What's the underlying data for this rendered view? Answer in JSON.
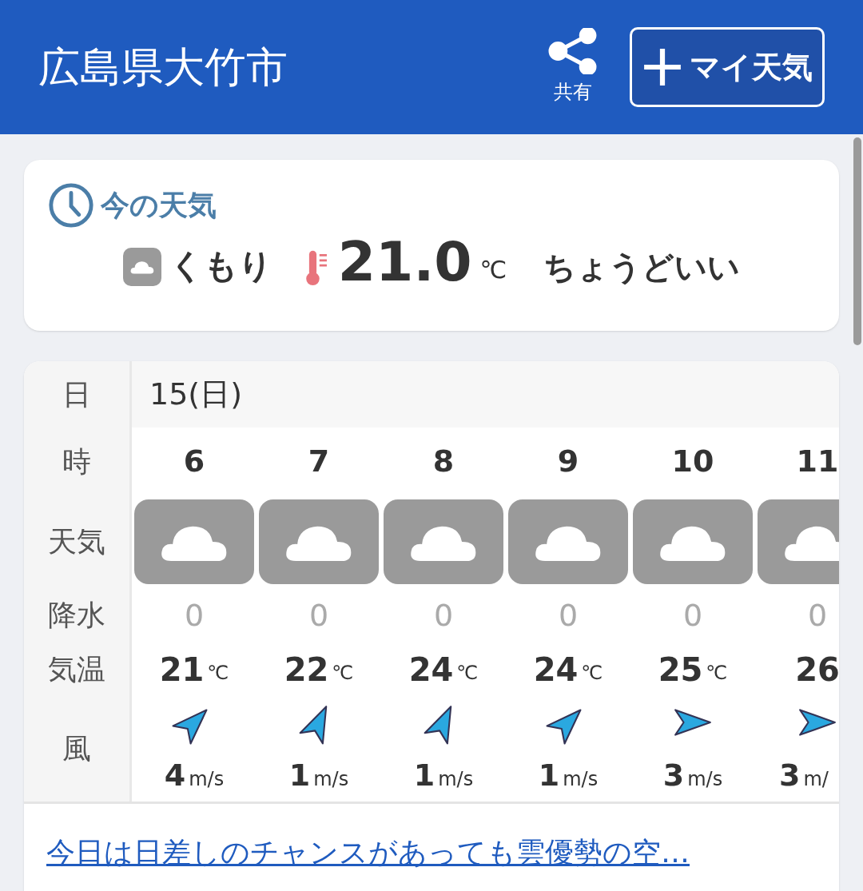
{
  "header": {
    "title": "広島県大竹市",
    "share_label": "共有",
    "my_weather_button": "マイ天気"
  },
  "current": {
    "heading": "今の天気",
    "condition": "くもり",
    "temperature": "21.0",
    "unit": "℃",
    "feeling": "ちょうどいい"
  },
  "forecast": {
    "row_labels": [
      "日",
      "時",
      "天気",
      "降水",
      "気温",
      "風"
    ],
    "date": "15(日)",
    "hours": [
      {
        "hour": "6",
        "kind": "cloudy",
        "precip": "0",
        "temp": "21",
        "temp_unit": "℃",
        "wind": {
          "kind": "northeast",
          "speed": "4",
          "unit": "m/s"
        }
      },
      {
        "hour": "7",
        "kind": "cloudy",
        "precip": "0",
        "temp": "22",
        "temp_unit": "℃",
        "wind": {
          "kind": "north-northeast",
          "speed": "1",
          "unit": "m/s"
        }
      },
      {
        "hour": "8",
        "kind": "cloudy",
        "precip": "0",
        "temp": "24",
        "temp_unit": "℃",
        "wind": {
          "kind": "north-northeast",
          "speed": "1",
          "unit": "m/s"
        }
      },
      {
        "hour": "9",
        "kind": "cloudy",
        "precip": "0",
        "temp": "24",
        "temp_unit": "℃",
        "wind": {
          "kind": "northeast",
          "speed": "1",
          "unit": "m/s"
        }
      },
      {
        "hour": "10",
        "kind": "cloudy",
        "precip": "0",
        "temp": "25",
        "temp_unit": "℃",
        "wind": {
          "kind": "east",
          "speed": "3",
          "unit": "m/s"
        }
      },
      {
        "hour": "11",
        "kind": "cloudy",
        "precip": "0",
        "temp": "26",
        "wind": {
          "kind": "east",
          "speed": "3",
          "unit": "m/"
        }
      }
    ]
  },
  "summary_link": "今日は日差しのチャンスがあっても雲優勢の空…"
}
